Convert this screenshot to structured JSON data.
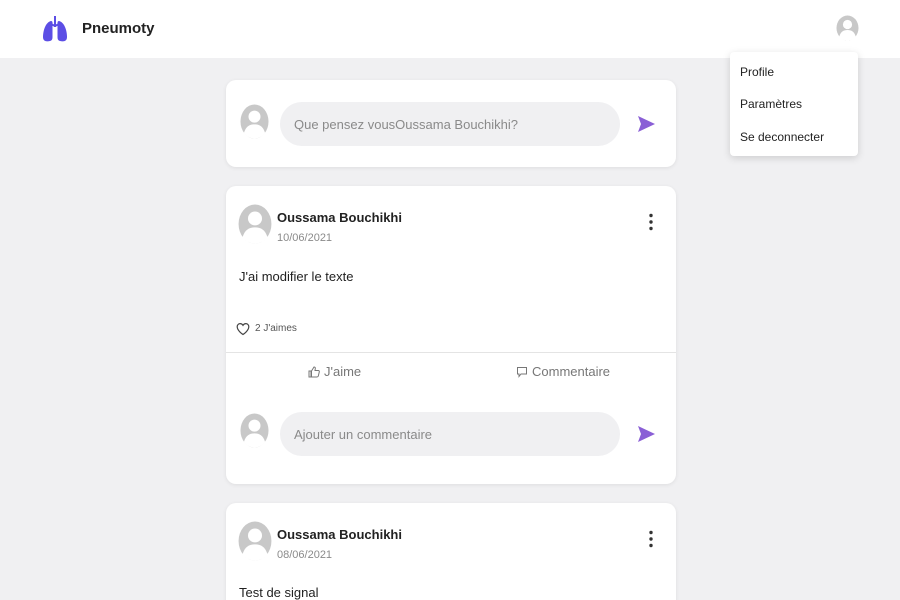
{
  "brand": {
    "name": "Pneumoty",
    "logo_icon": "lungs-icon",
    "accent": "#5c4ee5"
  },
  "menu": {
    "items": [
      {
        "label": "Profile"
      },
      {
        "label": "Paramètres"
      },
      {
        "label": "Se deconnecter"
      }
    ]
  },
  "composer": {
    "placeholder": "Que pensez vousOussama Bouchikhi?"
  },
  "posts": [
    {
      "author": "Oussama Bouchikhi",
      "date": "10/06/2021",
      "text": "J'ai modifier le texte",
      "likes": "2 J'aimes",
      "like_label": "J'aime",
      "comment_label": "Commentaire",
      "comment_placeholder": "Ajouter un commentaire"
    },
    {
      "author": "Oussama Bouchikhi",
      "date": "08/06/2021",
      "text": "Test de signal"
    }
  ],
  "colors": {
    "background": "#f0f0f2",
    "send": "#8a5fd6",
    "avatar": "#c8c8c8"
  }
}
